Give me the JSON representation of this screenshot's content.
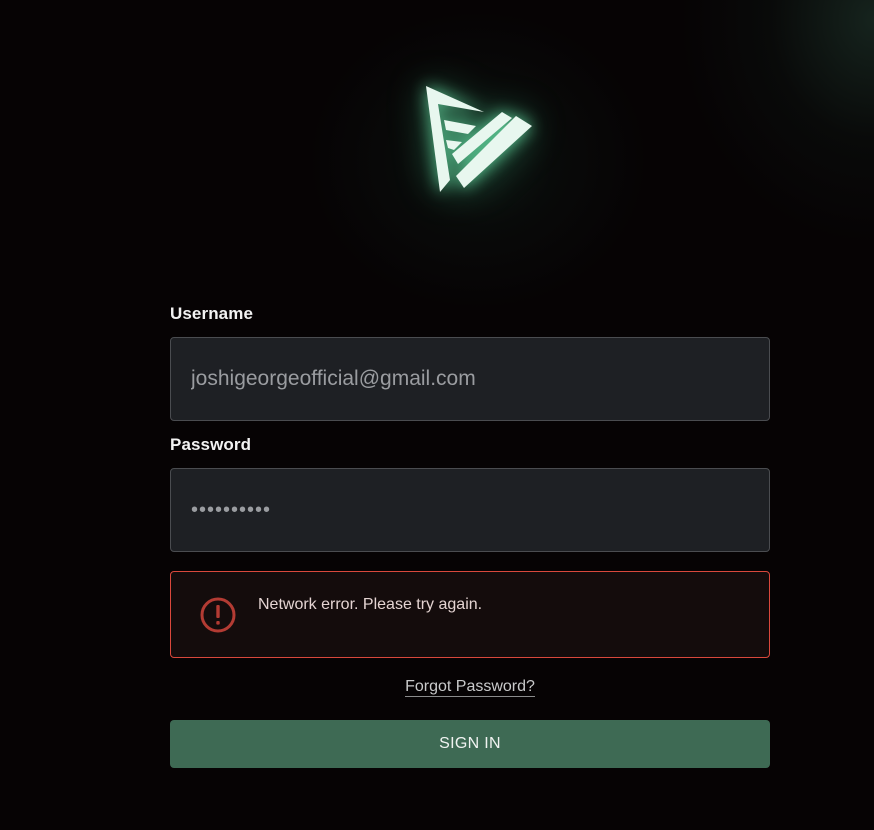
{
  "colors": {
    "accent": "#3e6a54",
    "logo": "#e6f5ee",
    "logo_glow": "#5fe3a6",
    "error_border": "#d9483c",
    "error_icon": "#b33b33",
    "input_bg": "#1e2024"
  },
  "logo": {
    "icon": "app-logo-icon"
  },
  "form": {
    "username_label": "Username",
    "username_value": "joshigeorgeofficial@gmail.com",
    "password_label": "Password",
    "password_value": "••••••••••"
  },
  "error": {
    "icon": "exclamation-circle-icon",
    "message": "Network error. Please try again."
  },
  "forgot_password_label": "Forgot Password?",
  "sign_in_label": "SIGN IN"
}
